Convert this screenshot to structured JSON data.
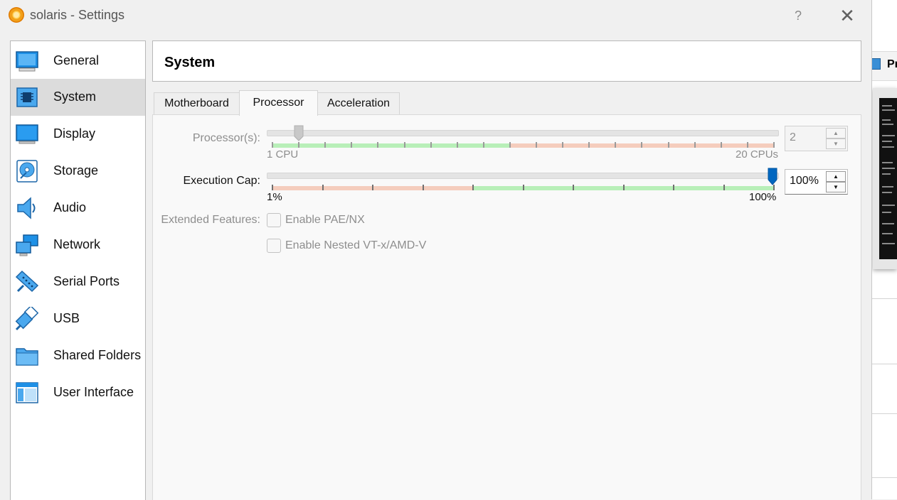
{
  "window": {
    "title": "solaris - Settings",
    "help": "?",
    "close": "✕"
  },
  "background_app": {
    "toolbar_text": "Pr"
  },
  "sidebar": {
    "items": [
      {
        "label": "General",
        "icon": "general-icon"
      },
      {
        "label": "System",
        "icon": "system-icon",
        "selected": true
      },
      {
        "label": "Display",
        "icon": "display-icon"
      },
      {
        "label": "Storage",
        "icon": "storage-icon"
      },
      {
        "label": "Audio",
        "icon": "audio-icon"
      },
      {
        "label": "Network",
        "icon": "network-icon"
      },
      {
        "label": "Serial Ports",
        "icon": "serial-ports-icon"
      },
      {
        "label": "USB",
        "icon": "usb-icon"
      },
      {
        "label": "Shared Folders",
        "icon": "shared-folders-icon"
      },
      {
        "label": "User Interface",
        "icon": "user-interface-icon"
      }
    ]
  },
  "page": {
    "title": "System",
    "tabs": [
      "Motherboard",
      "Processor",
      "Acceleration"
    ],
    "active_tab": "Processor"
  },
  "processor": {
    "label": "Processor(s):",
    "min_label": "1 CPU",
    "max_label": "20 CPUs",
    "value": "2",
    "level": {
      "value": 2,
      "min": 1,
      "max": 20
    },
    "enabled": false
  },
  "execution_cap": {
    "label": "Execution Cap:",
    "min_label": "1%",
    "max_label": "100%",
    "value": "100%",
    "level": {
      "value": 100,
      "min": 1,
      "max": 100
    },
    "enabled": true
  },
  "extended_features": {
    "label": "Extended Features:",
    "options": [
      {
        "label": "Enable PAE/NX",
        "checked": false,
        "enabled": false
      },
      {
        "label": "Enable Nested VT-x/AMD-V",
        "checked": false,
        "enabled": false
      }
    ]
  },
  "colors": {
    "accent": "#0067c0",
    "scale_green": "#b4f0b4",
    "scale_red": "#f5cbb8",
    "selected_row": "#dcdcdc"
  }
}
